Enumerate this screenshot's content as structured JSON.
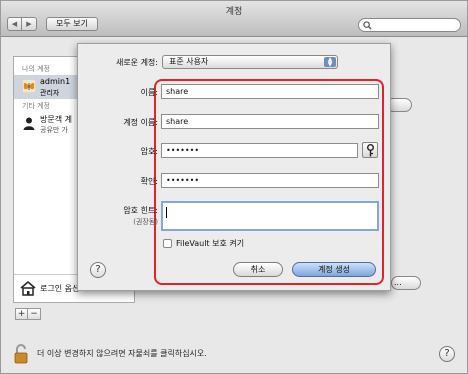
{
  "window": {
    "title": "계정"
  },
  "toolbar": {
    "show_all": "모두 보기",
    "back_icon": "chevron-left",
    "forward_icon": "chevron-right",
    "search_icon": "magnifier"
  },
  "sidebar": {
    "my_account_header": "나의 계정",
    "other_accounts_header": "기타 계정",
    "users": [
      {
        "name": "admin1",
        "role": "관리자",
        "icon": "butterfly-avatar"
      },
      {
        "name": "방문객 계",
        "role": "공유만 가",
        "icon": "silhouette-avatar"
      }
    ],
    "login_options": "로그인 옵션",
    "add_label": "+",
    "remove_label": "−"
  },
  "background_panel": {
    "button_partial": "..."
  },
  "lockbar": {
    "message": "더 이상 변경하지 않으려면 자물쇠를 클릭하십시오.",
    "help_label": "?"
  },
  "sheet": {
    "account_type_label": "새로운 계정:",
    "account_type_value": "표준 사용자",
    "name_label": "이름:",
    "name_value": "share",
    "account_name_label": "계정 이름:",
    "account_name_value": "share",
    "password_label": "암호:",
    "password_value": "•••••••",
    "verify_label": "확인:",
    "verify_value": "•••••••",
    "hint_label": "암호 힌트:",
    "hint_sublabel": "(권장됨)",
    "hint_value": "",
    "filevault_label": "FileVault 보호 켜기",
    "help_label": "?",
    "cancel_label": "취소",
    "create_label": "계정 생성"
  },
  "colors": {
    "highlight_border": "#e0252a",
    "default_button": "#7ea6dc"
  }
}
